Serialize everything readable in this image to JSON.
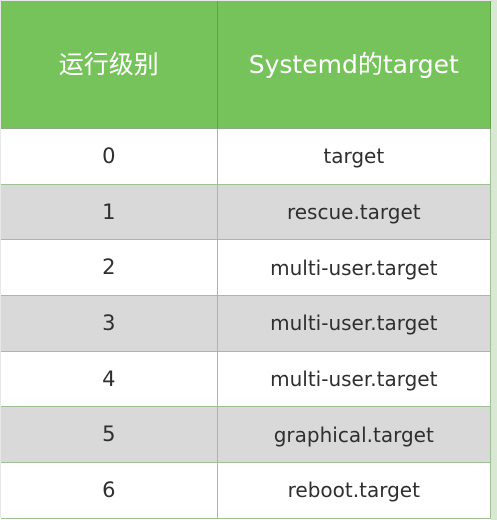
{
  "table": {
    "headers": [
      "运行级别",
      "Systemd的target"
    ],
    "rows": [
      {
        "level": "0",
        "target": "target"
      },
      {
        "level": "1",
        "target": "rescue.target"
      },
      {
        "level": "2",
        "target": "multi-user.target"
      },
      {
        "level": "3",
        "target": "multi-user.target"
      },
      {
        "level": "4",
        "target": "multi-user.target"
      },
      {
        "level": "5",
        "target": "graphical.target"
      },
      {
        "level": "6",
        "target": "reboot.target"
      }
    ]
  },
  "colors": {
    "header_bg": "#75c35a",
    "header_text": "#ffffff",
    "row_alt_bg": "#d9d9d9",
    "row_bg": "#ffffff",
    "grid_line": "#9fbf95"
  }
}
